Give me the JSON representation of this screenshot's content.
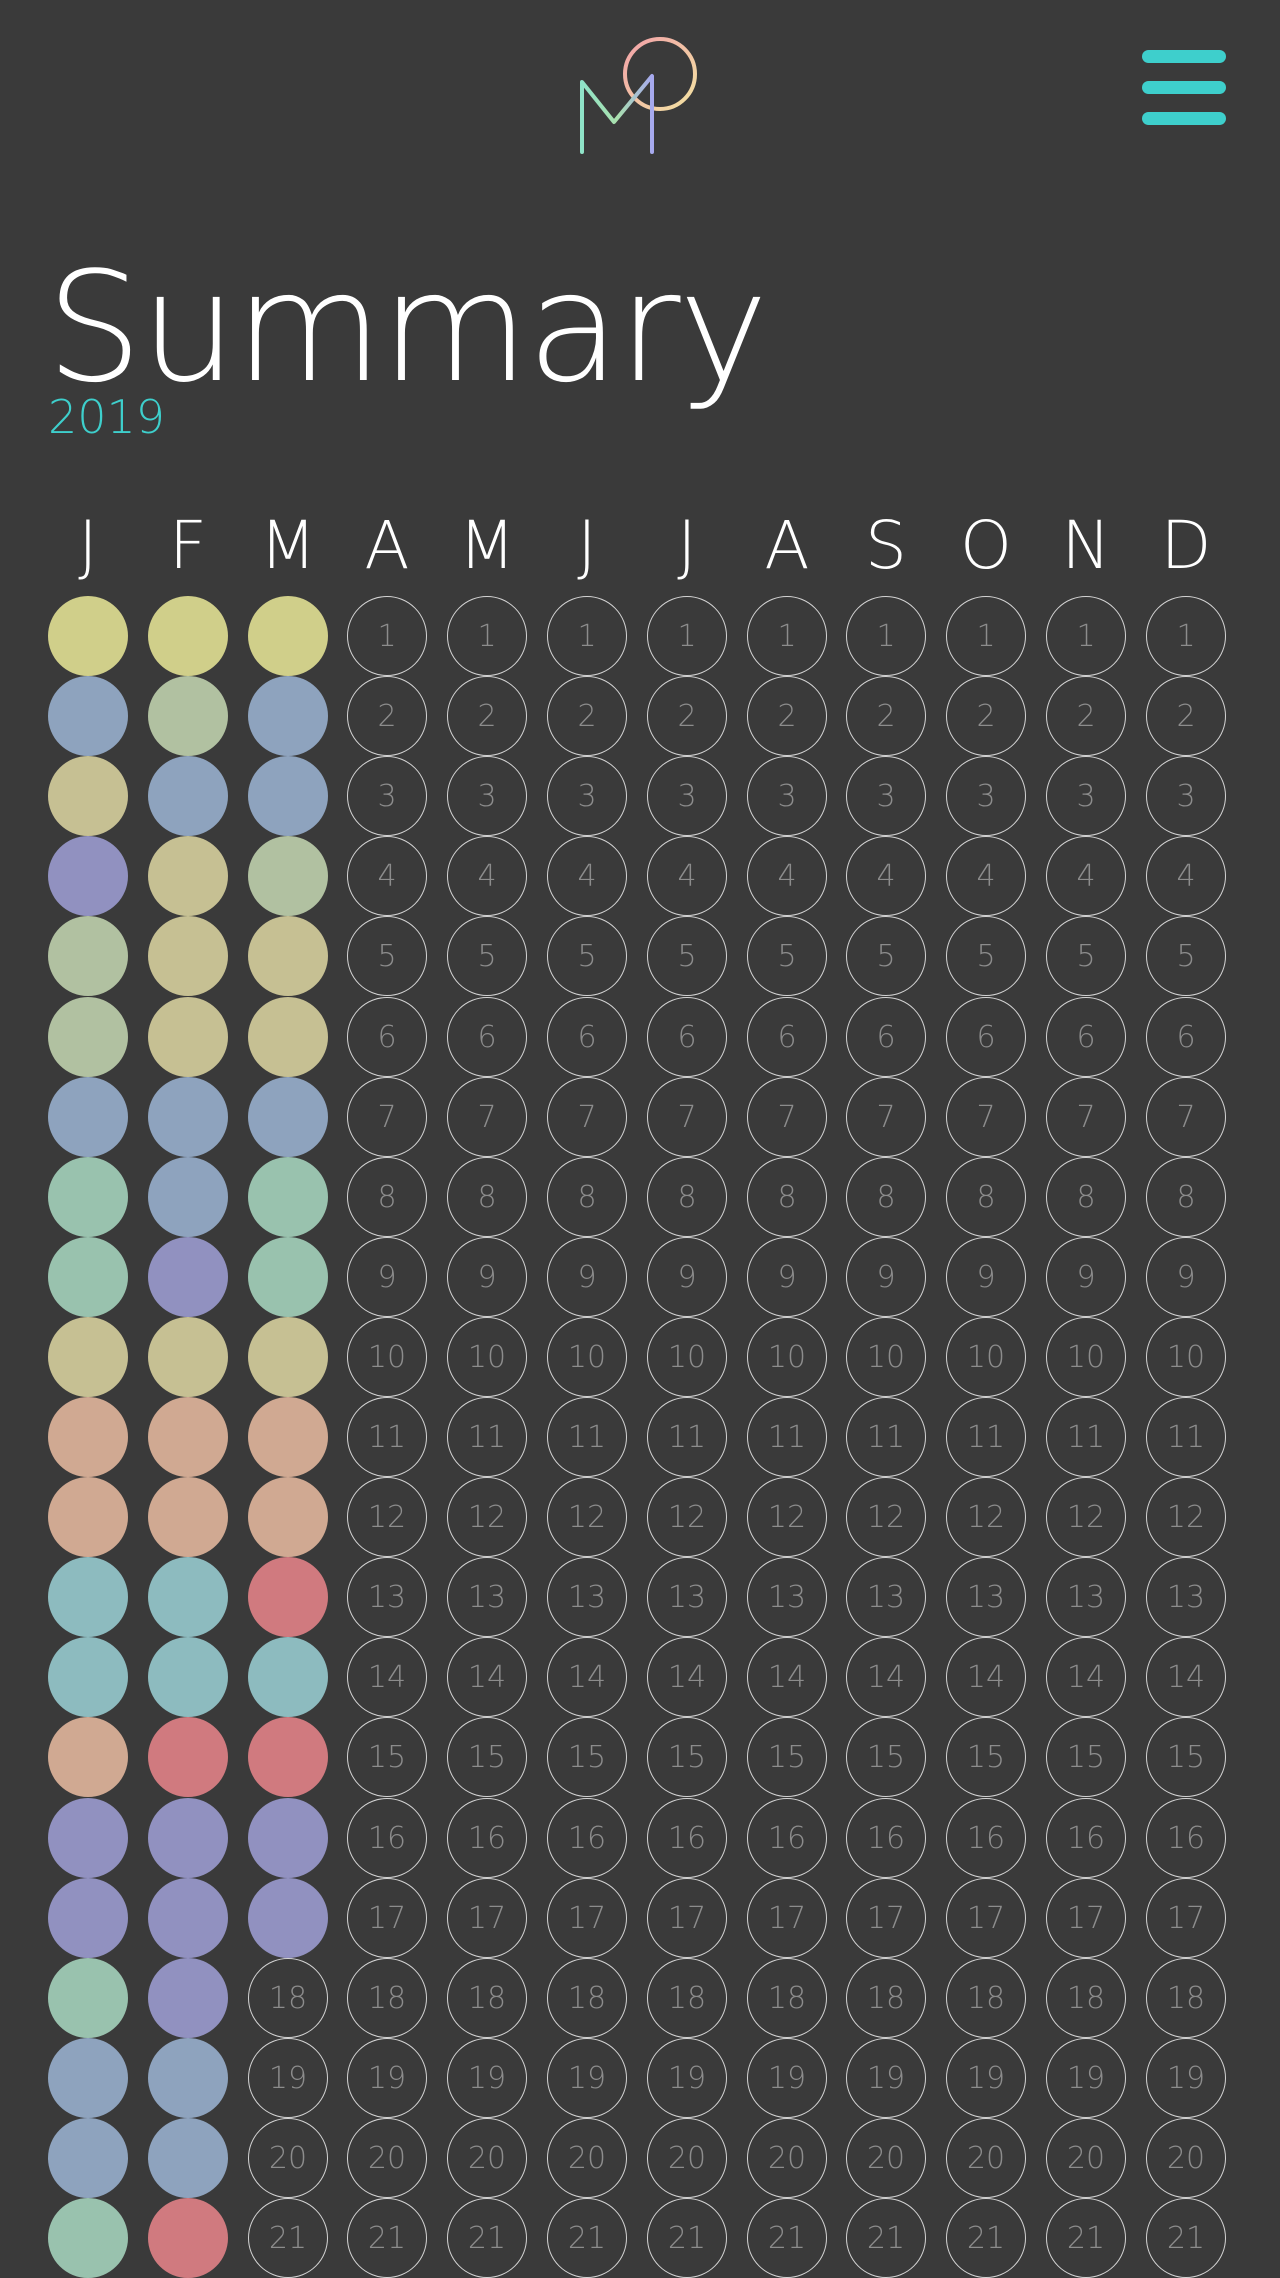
{
  "app": {
    "logo_icon": "mood-logo-icon",
    "menu_icon": "hamburger-menu-icon",
    "accent_color": "#3ecfcc"
  },
  "page": {
    "title": "Summary",
    "year": "2019"
  },
  "calendar": {
    "months": [
      "J",
      "F",
      "M",
      "A",
      "M",
      "J",
      "J",
      "A",
      "S",
      "O",
      "N",
      "D"
    ],
    "days": [
      "1",
      "2",
      "3",
      "4",
      "5",
      "6",
      "7",
      "8",
      "9",
      "10",
      "11",
      "12",
      "13",
      "14",
      "15",
      "16",
      "17",
      "18",
      "19",
      "20",
      "21"
    ],
    "mood_colors": {
      "yellow": "#d0cf8a",
      "blue": "#8ea3be",
      "sand": "#c6c093",
      "purple": "#9191c0",
      "sage": "#b1c1a1",
      "mint": "#99c2ae",
      "peach": "#d0a992",
      "teal": "#8dbbbf",
      "red": "#d07a7f"
    },
    "moods": [
      [
        "yellow",
        "blue",
        "sand",
        "purple",
        "sage",
        "sage",
        "blue",
        "mint",
        "mint",
        "sand",
        "peach",
        "peach",
        "teal",
        "teal",
        "peach",
        "purple",
        "purple",
        "mint",
        "blue",
        "blue",
        "mint"
      ],
      [
        "yellow",
        "sage",
        "blue",
        "sand",
        "sand",
        "sand",
        "blue",
        "blue",
        "purple",
        "sand",
        "peach",
        "peach",
        "teal",
        "teal",
        "red",
        "purple",
        "purple",
        "purple",
        "blue",
        "blue",
        "red"
      ],
      [
        "yellow",
        "blue",
        "blue",
        "sage",
        "sand",
        "sand",
        "blue",
        "mint",
        "mint",
        "sand",
        "peach",
        "peach",
        "red",
        "teal",
        "red",
        "purple",
        "purple"
      ]
    ]
  }
}
